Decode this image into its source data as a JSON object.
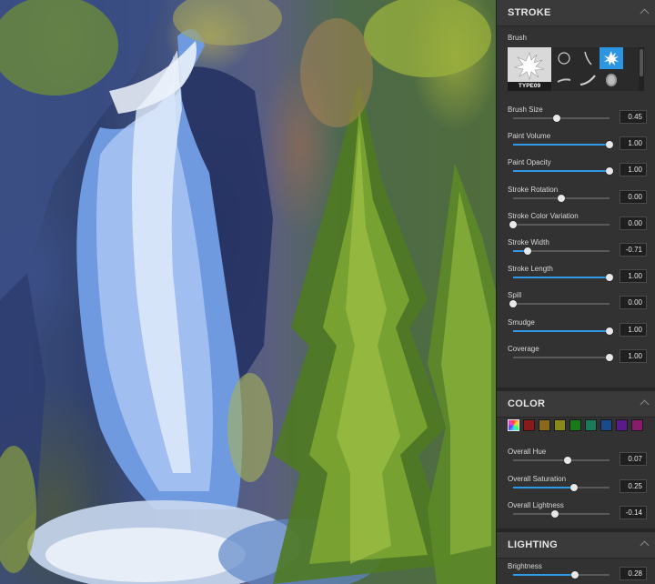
{
  "sections": {
    "stroke": {
      "title": "STROKE"
    },
    "color": {
      "title": "COLOR"
    },
    "lighting": {
      "title": "LIGHTING"
    }
  },
  "brush": {
    "label": "Brush",
    "selected_name": "TYPE09",
    "thumbnails": [
      "loop-brush-icon",
      "curve-brush-icon",
      "splatter-brush-icon",
      "smear-brush-icon",
      "feather-brush-icon",
      "sponge-brush-icon"
    ]
  },
  "stroke_params": [
    {
      "label": "Brush Size",
      "value": "0.45",
      "fraction": 0.45,
      "filled": false
    },
    {
      "label": "Paint Volume",
      "value": "1.00",
      "fraction": 1.0,
      "filled": true
    },
    {
      "label": "Paint Opacity",
      "value": "1.00",
      "fraction": 1.0,
      "filled": true
    },
    {
      "label": "Stroke Rotation",
      "value": "0.00",
      "fraction": 0.5,
      "filled": false
    },
    {
      "label": "Stroke Color Variation",
      "value": "0.00",
      "fraction": 0.0,
      "filled": false
    },
    {
      "label": "Stroke Width",
      "value": "-0.71",
      "fraction": 0.15,
      "filled": true
    },
    {
      "label": "Stroke Length",
      "value": "1.00",
      "fraction": 1.0,
      "filled": true
    },
    {
      "label": "Spill",
      "value": "0.00",
      "fraction": 0.0,
      "filled": false
    },
    {
      "label": "Smudge",
      "value": "1.00",
      "fraction": 1.0,
      "filled": true
    },
    {
      "label": "Coverage",
      "value": "1.00",
      "fraction": 1.0,
      "filled": false
    }
  ],
  "color_swatches": [
    "#c0c0c0",
    "#8a1a1a",
    "#8a6a1a",
    "#8a8a1a",
    "#1a7a1a",
    "#1a7a5a",
    "#1a4a8a",
    "#5a1a8a",
    "#8a1a6a"
  ],
  "color_params": [
    {
      "label": "Overall Hue",
      "value": "0.07",
      "fraction": 0.57,
      "filled": false
    },
    {
      "label": "Overall Saturation",
      "value": "0.25",
      "fraction": 0.63,
      "filled": true
    },
    {
      "label": "Overall Lightness",
      "value": "-0.14",
      "fraction": 0.43,
      "filled": false
    }
  ],
  "lighting_params": [
    {
      "label": "Brightness",
      "value": "0.28",
      "fraction": 0.64,
      "filled": true
    }
  ]
}
